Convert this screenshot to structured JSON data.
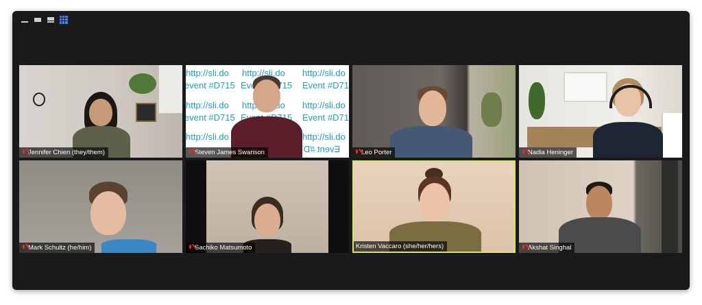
{
  "toolbar": {
    "icons": [
      "minimize-icon",
      "single-view-icon",
      "speaker-view-icon",
      "gallery-view-icon"
    ],
    "active_view": "gallery"
  },
  "accent_colors": {
    "muted_mic": "#e0302c",
    "active_speaker_border": "#d8e36b",
    "gallery_icon": "#2b8cff"
  },
  "participants": [
    {
      "name": "Jennifer Chien (they/them)",
      "muted": true
    },
    {
      "name": "Steven James Swanson",
      "muted": true
    },
    {
      "name": "Leo Porter",
      "muted": true
    },
    {
      "name": "Nadia Heninger",
      "muted": true
    },
    {
      "name": "Mark Schultz (he/him)",
      "muted": true
    },
    {
      "name": "Sachiko Matsumoto",
      "muted": true
    },
    {
      "name": "Kristen Vaccaro (she/her/hers)",
      "muted": false
    },
    {
      "name": "Akshat Singhal",
      "muted": true
    }
  ],
  "slido_background": {
    "url_text": "http://sli.do",
    "event_text": "Event #D715",
    "event_text_a": "event #D715",
    "event_text_b": "Event #D71",
    "event_text_c": "Event #D715"
  }
}
